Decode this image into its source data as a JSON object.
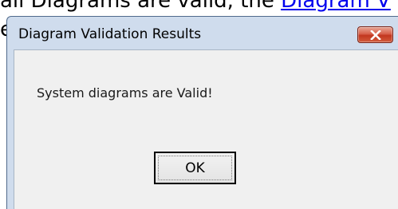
{
  "background": {
    "text_before": "all Diagrams are valid, the ",
    "link": "Diagram V",
    "fragment": "e"
  },
  "dialog": {
    "title": "Diagram Validation Results",
    "message": "System diagrams are Valid!",
    "ok_label": "OK",
    "close_icon": "close-x"
  },
  "colors": {
    "frame": "#cfdced",
    "client": "#f0f0f0",
    "close_button": "#c2361f",
    "link": "#0000ee"
  }
}
